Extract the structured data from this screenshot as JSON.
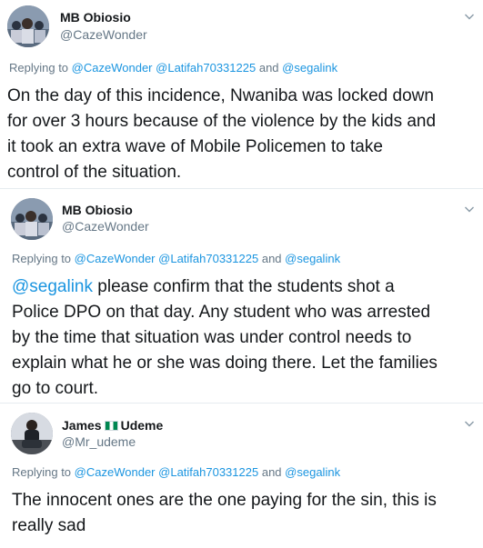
{
  "tweets": [
    {
      "author": {
        "name": "MB Obiosio",
        "handle": "@CazeWonder",
        "avatar_icon": "profile-photo-avatar"
      },
      "replying_prefix": "Replying to",
      "replying_to": [
        "@CazeWonder",
        "@Latifah70331225"
      ],
      "replying_and": "and",
      "replying_last": "@segalink",
      "body": "On the day of this incidence, Nwaniba was locked down\nfor over 3 hours because of the violence by the kids and\nit took an extra wave of Mobile Policemen to take\ncontrol of the situation."
    },
    {
      "author": {
        "name": "MB Obiosio",
        "handle": "@CazeWonder",
        "avatar_icon": "profile-photo-avatar"
      },
      "replying_prefix": "Replying to",
      "replying_to": [
        "@CazeWonder",
        "@Latifah70331225"
      ],
      "replying_and": "and",
      "replying_last": "@segalink",
      "body_mention": "@segalink",
      "body": " please confirm that the students shot a\nPolice DPO on that day. Any student who was arrested\nby the time that situation was under control needs to\nexplain what he or she was doing there. Let the families\ngo to court."
    },
    {
      "author": {
        "name_first": "James",
        "name_last": "Udeme",
        "flag_icon": "nigeria-flag-icon",
        "handle": "@Mr_udeme",
        "avatar_icon": "profile-photo-avatar"
      },
      "replying_prefix": "Replying to",
      "replying_to": [
        "@CazeWonder",
        "@Latifah70331225"
      ],
      "replying_and": "and",
      "replying_last": "@segalink",
      "body": "The innocent ones are the one paying for the sin, this is\nreally sad"
    }
  ],
  "colors": {
    "text": "#14171a",
    "secondary": "#657786",
    "link": "#1b95e0",
    "divider": "#e6ecf0",
    "flag_green": "#008751"
  },
  "icons": {
    "more": "chevron-down-icon"
  }
}
